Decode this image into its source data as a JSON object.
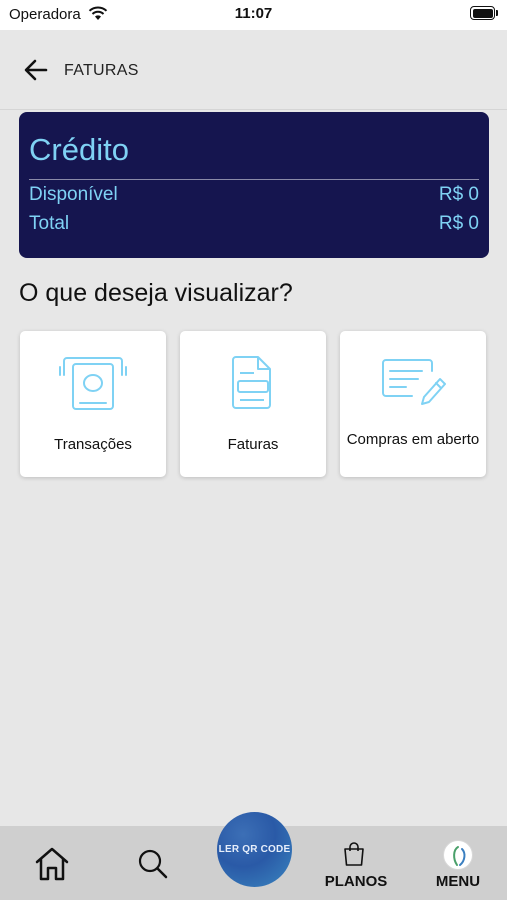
{
  "status_bar": {
    "carrier": "Operadora",
    "time": "11:07",
    "icons": [
      "wifi-icon",
      "battery-icon"
    ]
  },
  "header": {
    "title": "FATURAS",
    "back_icon": "arrow-left-icon"
  },
  "credit": {
    "title": "Crédito",
    "available_label": "Disponível",
    "available_value": "R$ 0",
    "total_label": "Total",
    "total_value": "R$ 0",
    "colors": {
      "background": "#15154f",
      "text": "#7fd2f4"
    }
  },
  "question": "O que deseja visualizar?",
  "options": [
    {
      "label": "Transações",
      "icon": "cash-withdrawal-icon"
    },
    {
      "label": "Faturas",
      "icon": "invoice-document-icon"
    },
    {
      "label": "Compras em aberto",
      "icon": "signature-form-icon"
    }
  ],
  "bottom_nav": {
    "home_icon": "home-icon",
    "search_icon": "search-icon",
    "qr_label": "LER QR CODE",
    "planos_label": "PLANOS",
    "planos_icon": "shopping-bag-icon",
    "menu_label": "MENU",
    "menu_icon": "brand-logo-icon"
  },
  "accent_color": "#7fd2f4"
}
